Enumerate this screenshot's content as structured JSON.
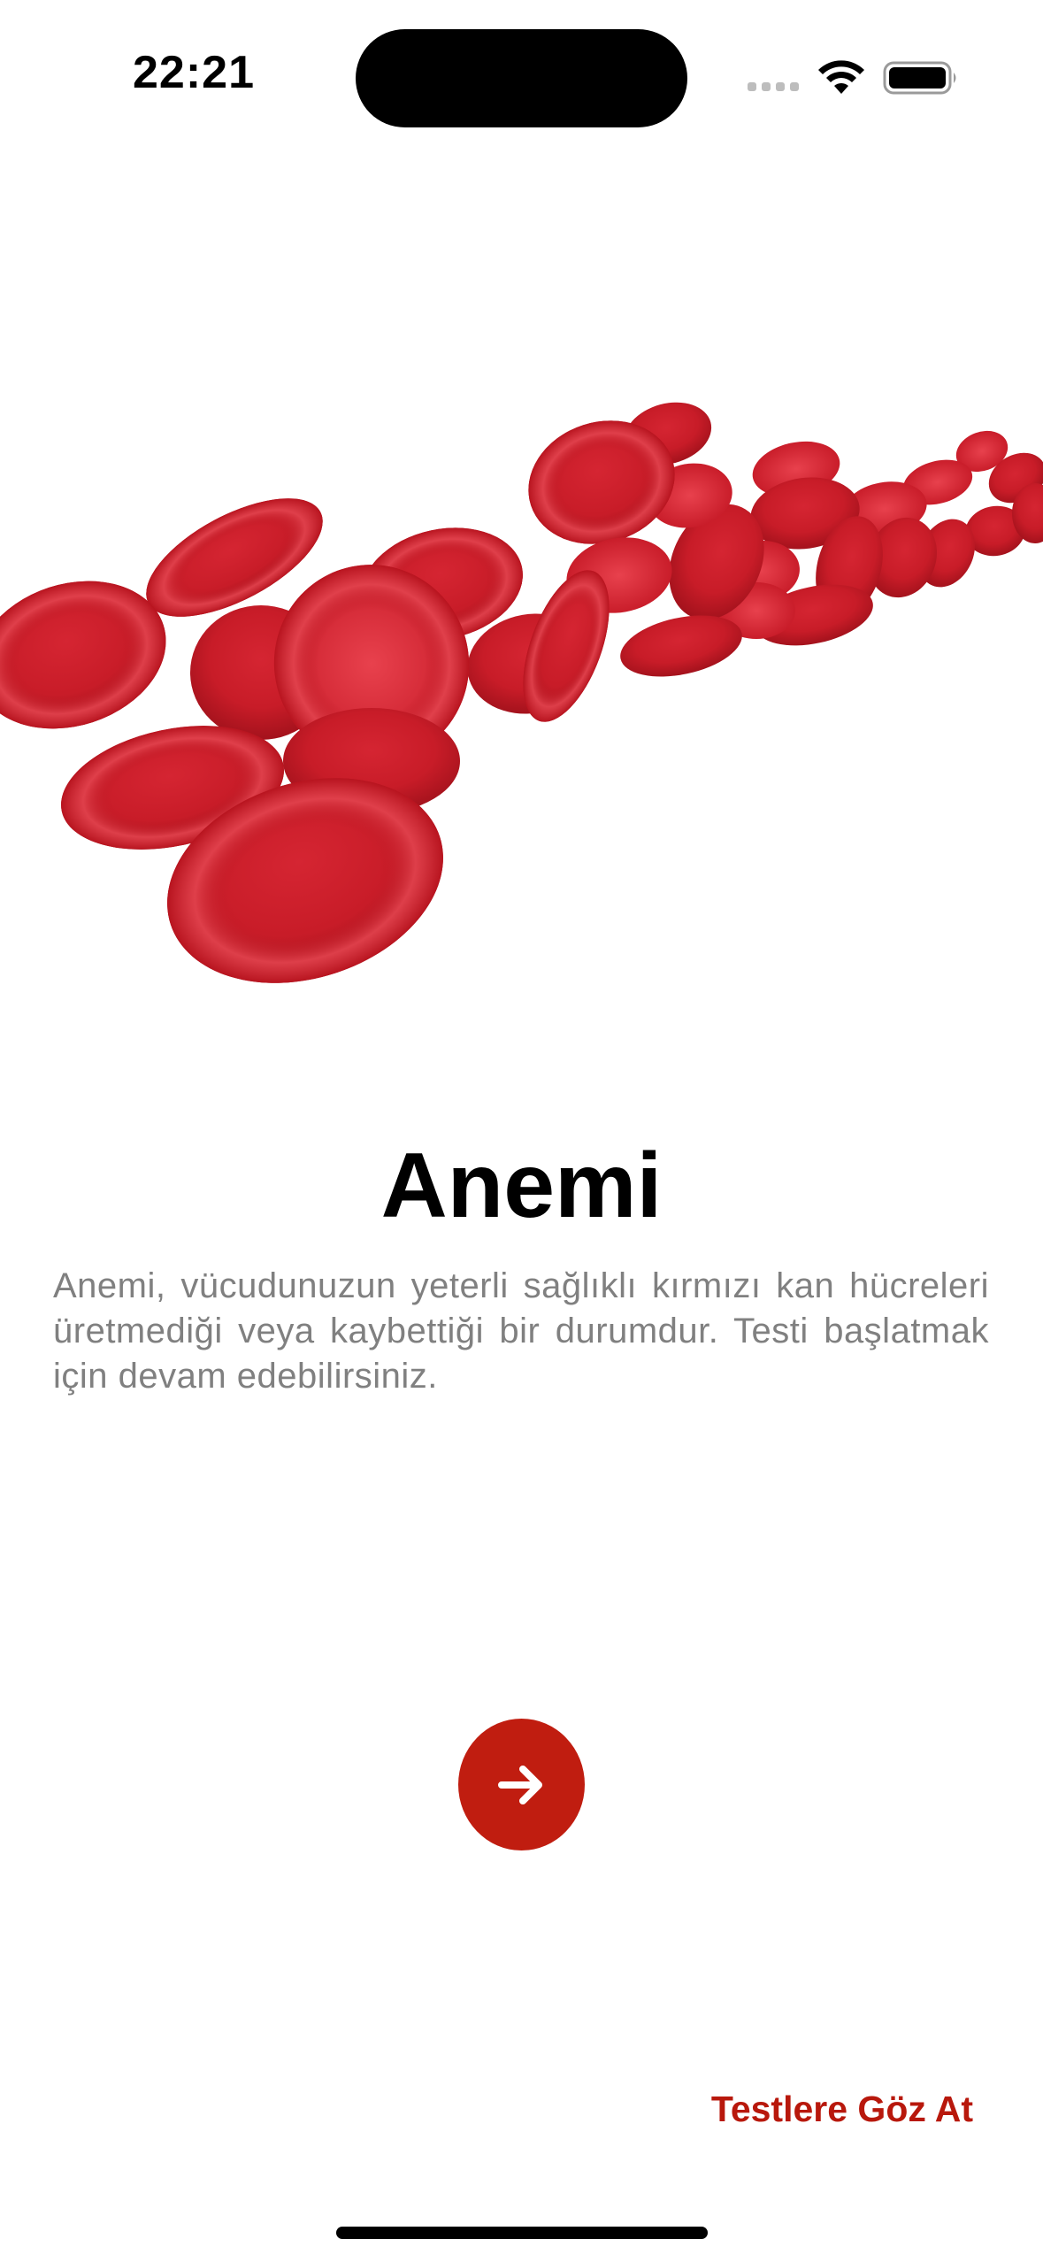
{
  "status_bar": {
    "time": "22:21",
    "wifi_icon": "wifi-icon",
    "battery_icon": "battery-full-icon",
    "signal_icon": "cellular-signal-icon"
  },
  "onboarding": {
    "illustration": "red-blood-cells-image",
    "title": "Anemi",
    "description": "Anemi, vücudunuzun yeterli sağlıklı kırmızı kan hücreleri üretmediği veya kaybettiği bir durumdur. Testi başlatmak için devam edebilirsiniz.",
    "next_icon": "arrow-right-icon",
    "browse_tests_label": "Testlere Göz At"
  },
  "colors": {
    "accent": "#c01d10",
    "link": "#b8180c",
    "description_text": "#808080",
    "title_text": "#000000"
  }
}
